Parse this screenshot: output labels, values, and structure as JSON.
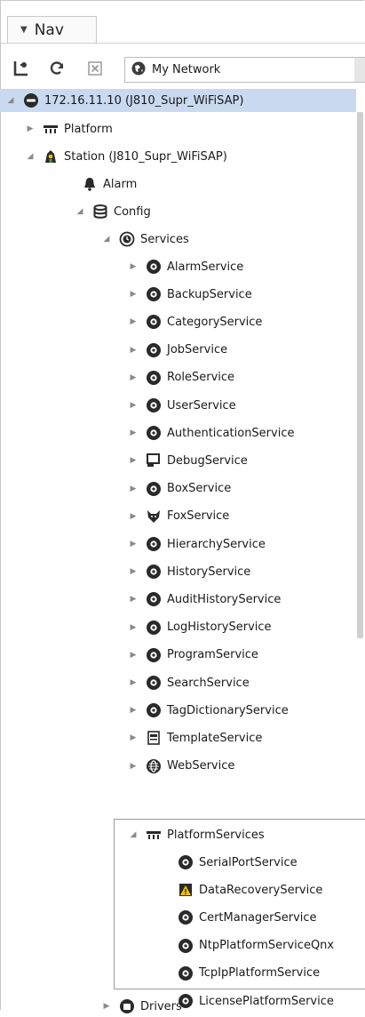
{
  "tab": {
    "label": "Nav"
  },
  "toolbar": {
    "network_label": "My Network"
  },
  "colors": {
    "selection": "#c9d9ef",
    "icon_dark": "#3a3a3a",
    "scroll": "#cfcfcf",
    "warn": "#f2c100"
  },
  "tree": {
    "host": "172.16.11.10 (J810_Supr_WiFiSAP)",
    "platform": "Platform",
    "station": "Station (J810_Supr_WiFiSAP)",
    "alarm": "Alarm",
    "config": "Config",
    "services": "Services",
    "service_items": [
      {
        "label": "AlarmService",
        "icon": "bell-circle-icon"
      },
      {
        "label": "BackupService",
        "icon": "clock-circle-icon"
      },
      {
        "label": "CategoryService",
        "icon": "pie-circle-icon"
      },
      {
        "label": "JobService",
        "icon": "job-circle-icon"
      },
      {
        "label": "RoleService",
        "icon": "role-circle-icon"
      },
      {
        "label": "UserService",
        "icon": "user-circle-icon"
      },
      {
        "label": "AuthenticationService",
        "icon": "lock-circle-icon"
      },
      {
        "label": "DebugService",
        "icon": "debug-window-icon"
      },
      {
        "label": "BoxService",
        "icon": "box-circle-icon"
      },
      {
        "label": "FoxService",
        "icon": "fox-icon"
      },
      {
        "label": "HierarchyService",
        "icon": "hierarchy-circle-icon"
      },
      {
        "label": "HistoryService",
        "icon": "history-circle-icon"
      },
      {
        "label": "AuditHistoryService",
        "icon": "audit-circle-icon"
      },
      {
        "label": "LogHistoryService",
        "icon": "log-circle-icon"
      },
      {
        "label": "ProgramService",
        "icon": "program-circle-icon"
      },
      {
        "label": "SearchService",
        "icon": "search-circle-icon"
      },
      {
        "label": "TagDictionaryService",
        "icon": "tag-circle-icon"
      },
      {
        "label": "TemplateService",
        "icon": "template-icon"
      },
      {
        "label": "WebService",
        "icon": "globe-circle-icon"
      }
    ],
    "platform_services": "PlatformServices",
    "platform_items": [
      {
        "label": "SerialPortService",
        "icon": "serial-circle-icon"
      },
      {
        "label": "DataRecoveryService",
        "icon": "data-recovery-warning-icon"
      },
      {
        "label": "CertManagerService",
        "icon": "cert-circle-icon"
      },
      {
        "label": "NtpPlatformServiceQnx",
        "icon": "ntp-circle-icon"
      },
      {
        "label": "TcpIpPlatformService",
        "icon": "tcpip-circle-icon"
      },
      {
        "label": "LicensePlatformService",
        "icon": "license-circle-icon"
      }
    ],
    "drivers": "Drivers"
  }
}
